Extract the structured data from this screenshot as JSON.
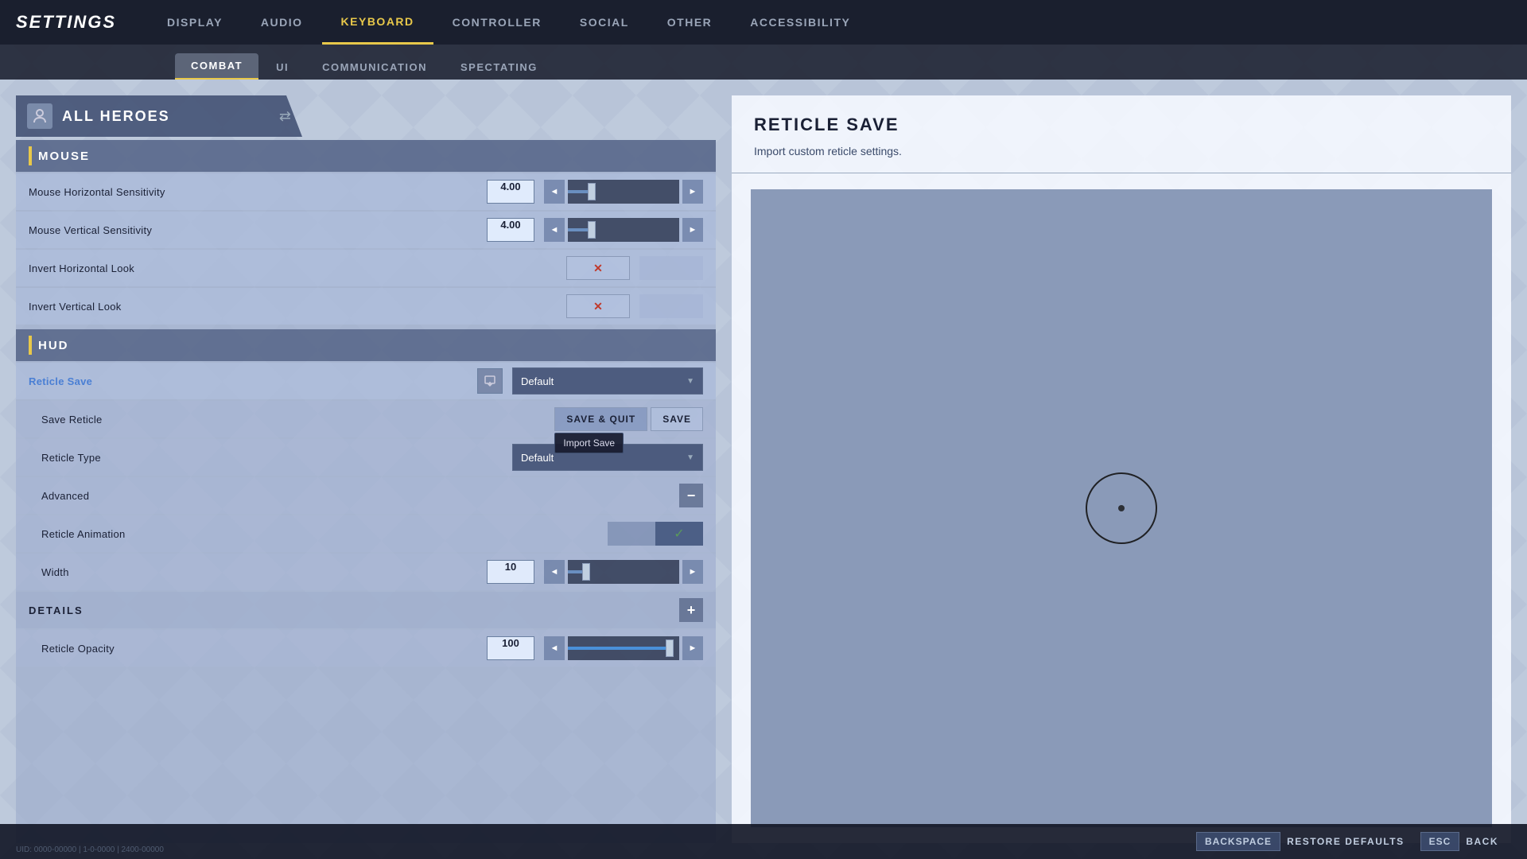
{
  "topNav": {
    "logo": "SETTINGS",
    "items": [
      {
        "id": "display",
        "label": "DISPLAY",
        "active": false
      },
      {
        "id": "audio",
        "label": "AUDIO",
        "active": false
      },
      {
        "id": "keyboard",
        "label": "KEYBOARD",
        "active": true
      },
      {
        "id": "controller",
        "label": "CONTROLLER",
        "active": false
      },
      {
        "id": "social",
        "label": "SOCIAL",
        "active": false
      },
      {
        "id": "other",
        "label": "OTHER",
        "active": false
      },
      {
        "id": "accessibility",
        "label": "ACCESSIBILITY",
        "active": false
      }
    ]
  },
  "subTabs": [
    {
      "id": "combat",
      "label": "COMBAT",
      "active": true
    },
    {
      "id": "ui",
      "label": "UI",
      "active": false
    },
    {
      "id": "communication",
      "label": "COMMUNICATION",
      "active": false
    },
    {
      "id": "spectating",
      "label": "SPECTATING",
      "active": false
    }
  ],
  "heroSelector": {
    "name": "ALL HEROES",
    "icon": "⊕"
  },
  "sections": {
    "mouse": {
      "title": "MOUSE",
      "settings": [
        {
          "id": "mouse-h-sens",
          "label": "Mouse Horizontal Sensitivity",
          "value": "4.00",
          "sliderPos": 20
        },
        {
          "id": "mouse-v-sens",
          "label": "Mouse Vertical Sensitivity",
          "value": "4.00",
          "sliderPos": 20
        },
        {
          "id": "invert-h",
          "label": "Invert Horizontal Look",
          "type": "toggle",
          "value": false
        },
        {
          "id": "invert-v",
          "label": "Invert Vertical Look",
          "type": "toggle",
          "value": false
        }
      ]
    },
    "hud": {
      "title": "HUD",
      "settings": [
        {
          "id": "reticle-save",
          "label": "Reticle Save",
          "type": "dropdown",
          "value": "Default"
        },
        {
          "id": "save-reticle",
          "label": "Save Reticle",
          "type": "save-buttons"
        },
        {
          "id": "reticle-type",
          "label": "Reticle Type",
          "type": "dropdown",
          "value": "Default"
        },
        {
          "id": "advanced",
          "label": "Advanced",
          "type": "collapse"
        },
        {
          "id": "reticle-animation",
          "label": "Reticle Animation",
          "type": "check-toggle"
        },
        {
          "id": "width",
          "label": "Width",
          "value": "10",
          "sliderPos": 15
        },
        {
          "id": "details",
          "label": "DETAILS",
          "type": "details"
        },
        {
          "id": "reticle-opacity",
          "label": "Reticle Opacity",
          "value": "100",
          "sliderPos": 90,
          "sliderColor": "blue"
        }
      ]
    }
  },
  "rightPanel": {
    "title": "RETICLE SAVE",
    "description": "Import custom reticle settings."
  },
  "bottomBar": {
    "backspaceLabel": "BACKSPACE",
    "restoreLabel": "RESTORE DEFAULTS",
    "escLabel": "ESC",
    "backLabel": "BACK"
  },
  "tooltip": {
    "importSave": "Import Save"
  },
  "uid": "UID: 0000-00000 | 1-0-0000 | 2400-00000"
}
